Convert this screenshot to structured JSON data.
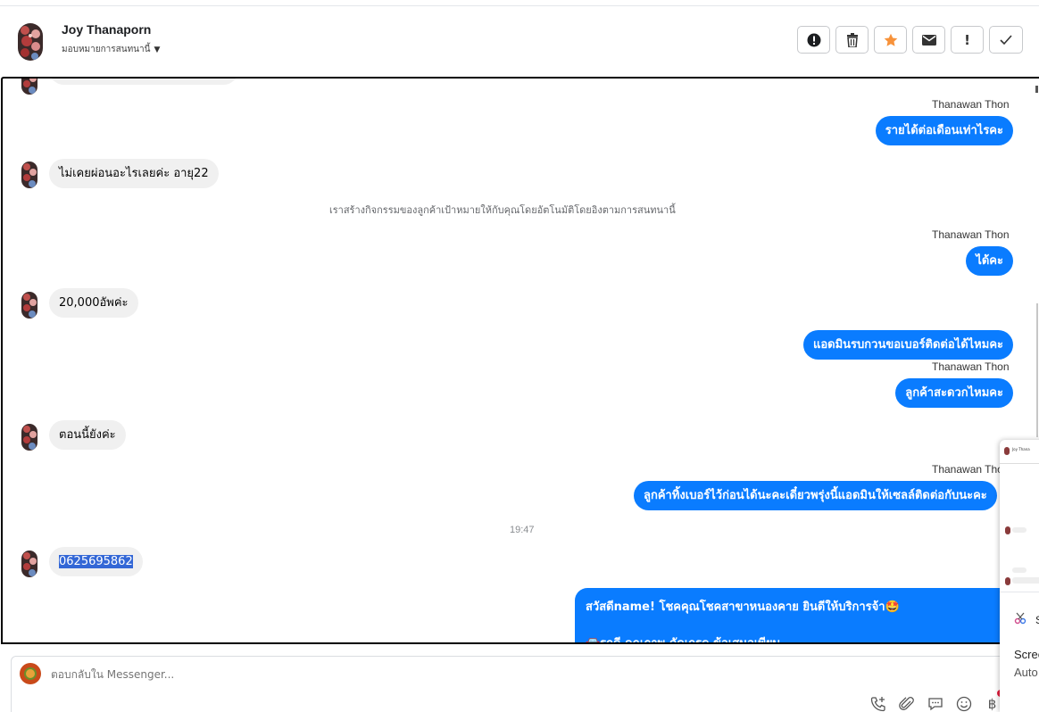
{
  "header": {
    "name": "Joy Thanaporn",
    "assign_label": "มอบหมายการสนทนานี้",
    "actions": [
      {
        "icon": "alert-circle-icon"
      },
      {
        "icon": "trash-icon"
      },
      {
        "icon": "star-icon"
      },
      {
        "icon": "envelope-icon"
      },
      {
        "icon": "exclamation-icon"
      },
      {
        "icon": "check-icon"
      }
    ]
  },
  "messages": {
    "m1_sender": "Thanawan Thon",
    "m1_text": "รายได้ต่อเดือนเท่าไรคะ",
    "m2_text": "ไม่เคยผ่อนอะไรเลยค่ะ อายุ22",
    "system_note": "เราสร้างกิจกรรมของลูกค้าเป้าหมายให้กับคุณโดยอัตโนมัติโดยอิงตามการสนทนานี้",
    "m3_sender": "Thanawan Thon",
    "m3_text": "ได้คะ",
    "m4_text": "20,000อัพค่ะ",
    "m5_text": "แอดมินรบกวนขอเบอร์ติดต่อได้ไหมคะ",
    "m6_sender": "Thanawan Thon",
    "m6_text": "ลูกค้าสะดวกไหมคะ",
    "m7_text": "ตอนนี้ยังค่ะ",
    "m8_sender": "Thanawan Thon",
    "m8_text": "ลูกค้าทิ้งเบอร์ไว้ก่อนได้นะคะเดี๋ยวพรุ่งนี้แอดมินให้เซลล์ติดต่อกับนะคะ",
    "timestamp": "19:47",
    "m9_text": "0625695862",
    "m10_line1": "สวัสดีname! โชคคุณโชคสาขาหนองคาย ยินดีให้บริการจ้า🤩",
    "m10_line2": "🚘รถดี คุณภาพ คัดเกรด ข้อเสนอเพียบ"
  },
  "composer": {
    "placeholder": "ตอบกลับใน Messenger...",
    "tools": [
      "phone-plus-icon",
      "paperclip-icon",
      "chat-bubble-icon",
      "smiley-icon",
      "baht-icon"
    ]
  },
  "popup": {
    "mini_name": "Joy Thana",
    "snip_label": "S",
    "line1": "Scree",
    "line2": "Auto"
  }
}
